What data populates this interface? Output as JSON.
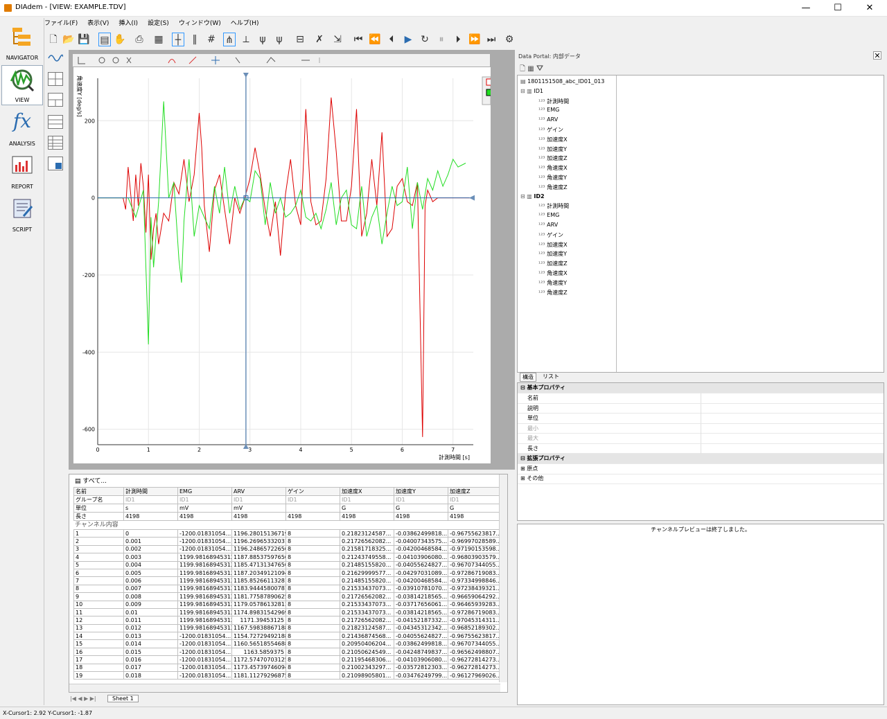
{
  "window": {
    "title": "DIAdem - [VIEW:  EXAMPLE.TDV]",
    "min": "—",
    "max": "☐",
    "close": "✕"
  },
  "menu": [
    "ファイル(F)",
    "表示(V)",
    "挿入(I)",
    "設定(S)",
    "ウィンドウ(W)",
    "ヘルプ(H)"
  ],
  "nav": [
    {
      "label": "NAVIGATOR",
      "icon": "navigator-icon"
    },
    {
      "label": "VIEW",
      "icon": "view-icon"
    },
    {
      "label": "ANALYSIS",
      "icon": "fx-icon"
    },
    {
      "label": "REPORT",
      "icon": "report-icon"
    },
    {
      "label": "SCRIPT",
      "icon": "script-icon"
    }
  ],
  "analysis_glyph": "fx",
  "chart_data": {
    "type": "line",
    "ylabel": "角速度Y [deg/s]",
    "xlabel": "計測時間 [s]",
    "xlim": [
      0,
      7.4
    ],
    "ylim": [
      -640,
      310
    ],
    "x_ticks": [
      "0",
      "1",
      "2",
      "3",
      "4",
      "5",
      "6",
      "7"
    ],
    "y_ticks": [
      "200",
      "0",
      "-200",
      "-400",
      "-600"
    ],
    "cursor_x": 2.92,
    "grid": true,
    "legend_position": "top-right",
    "series": [
      {
        "color": "#dd0000",
        "points": [
          [
            0,
            0
          ],
          [
            0.5,
            0
          ],
          [
            0.55,
            -30
          ],
          [
            0.6,
            80
          ],
          [
            0.7,
            -60
          ],
          [
            0.75,
            60
          ],
          [
            0.8,
            -20
          ],
          [
            0.85,
            90
          ],
          [
            0.9,
            30
          ],
          [
            0.95,
            -90
          ],
          [
            1.0,
            60
          ],
          [
            1.05,
            -160
          ],
          [
            1.1,
            -80
          ],
          [
            1.15,
            -40
          ],
          [
            1.2,
            -120
          ],
          [
            1.3,
            -40
          ],
          [
            1.4,
            -60
          ],
          [
            1.5,
            40
          ],
          [
            1.6,
            10
          ],
          [
            1.7,
            100
          ],
          [
            1.8,
            -10
          ],
          [
            1.9,
            60
          ],
          [
            2.0,
            220
          ],
          [
            2.05,
            130
          ],
          [
            2.1,
            -20
          ],
          [
            2.2,
            -140
          ],
          [
            2.3,
            20
          ],
          [
            2.4,
            60
          ],
          [
            2.5,
            -30
          ],
          [
            2.6,
            -120
          ],
          [
            2.7,
            0
          ],
          [
            2.8,
            -40
          ],
          [
            2.9,
            0
          ],
          [
            3.0,
            50
          ],
          [
            3.1,
            130
          ],
          [
            3.2,
            60
          ],
          [
            3.3,
            -30
          ],
          [
            3.4,
            -100
          ],
          [
            3.5,
            -10
          ],
          [
            3.6,
            -150
          ],
          [
            3.7,
            10
          ],
          [
            3.8,
            100
          ],
          [
            3.9,
            -20
          ],
          [
            4.0,
            -70
          ],
          [
            4.1,
            230
          ],
          [
            4.2,
            -10
          ],
          [
            4.3,
            -70
          ],
          [
            4.4,
            -60
          ],
          [
            4.5,
            50
          ],
          [
            4.6,
            260
          ],
          [
            4.7,
            120
          ],
          [
            4.8,
            -60
          ],
          [
            4.9,
            -60
          ],
          [
            5.0,
            30
          ],
          [
            5.1,
            230
          ],
          [
            5.2,
            -100
          ],
          [
            5.3,
            -40
          ],
          [
            5.4,
            100
          ],
          [
            5.5,
            -20
          ],
          [
            5.6,
            170
          ],
          [
            5.7,
            -100
          ],
          [
            5.8,
            -80
          ],
          [
            5.9,
            30
          ],
          [
            6.0,
            50
          ],
          [
            6.1,
            -10
          ],
          [
            6.2,
            -20
          ],
          [
            6.3,
            40
          ],
          [
            6.4,
            -620
          ],
          [
            6.45,
            -20
          ],
          [
            6.5,
            20
          ],
          [
            6.6,
            -10
          ],
          [
            6.7,
            0
          ],
          [
            7.4,
            0
          ]
        ]
      },
      {
        "color": "#22dd22",
        "points": [
          [
            0,
            0
          ],
          [
            0.6,
            0
          ],
          [
            0.75,
            -50
          ],
          [
            0.9,
            20
          ],
          [
            1.0,
            -380
          ],
          [
            1.05,
            -50
          ],
          [
            1.1,
            -180
          ],
          [
            1.2,
            -10
          ],
          [
            1.3,
            250
          ],
          [
            1.4,
            0
          ],
          [
            1.5,
            40
          ],
          [
            1.6,
            -160
          ],
          [
            1.65,
            -220
          ],
          [
            1.7,
            -60
          ],
          [
            1.8,
            100
          ],
          [
            1.9,
            -100
          ],
          [
            2.0,
            -20
          ],
          [
            2.1,
            -50
          ],
          [
            2.2,
            -80
          ],
          [
            2.3,
            30
          ],
          [
            2.4,
            -40
          ],
          [
            2.5,
            80
          ],
          [
            2.6,
            -40
          ],
          [
            2.7,
            30
          ],
          [
            2.8,
            -30
          ],
          [
            2.9,
            0
          ],
          [
            3.0,
            -10
          ],
          [
            3.1,
            70
          ],
          [
            3.2,
            50
          ],
          [
            3.3,
            -70
          ],
          [
            3.4,
            40
          ],
          [
            3.5,
            -40
          ],
          [
            3.6,
            0
          ],
          [
            3.7,
            -50
          ],
          [
            3.8,
            -40
          ],
          [
            3.9,
            -20
          ],
          [
            4.0,
            20
          ],
          [
            4.1,
            -50
          ],
          [
            4.2,
            -60
          ],
          [
            4.3,
            -40
          ],
          [
            4.4,
            -80
          ],
          [
            4.5,
            -30
          ],
          [
            4.6,
            40
          ],
          [
            4.7,
            -70
          ],
          [
            4.8,
            0
          ],
          [
            4.9,
            20
          ],
          [
            5.0,
            -70
          ],
          [
            5.1,
            -80
          ],
          [
            5.2,
            30
          ],
          [
            5.3,
            -100
          ],
          [
            5.4,
            -50
          ],
          [
            5.5,
            -20
          ],
          [
            5.6,
            -120
          ],
          [
            5.7,
            -40
          ],
          [
            5.8,
            30
          ],
          [
            5.9,
            -20
          ],
          [
            6.0,
            -10
          ],
          [
            6.1,
            80
          ],
          [
            6.2,
            -80
          ],
          [
            6.3,
            40
          ],
          [
            6.4,
            -30
          ],
          [
            6.5,
            50
          ],
          [
            6.6,
            20
          ],
          [
            6.7,
            70
          ],
          [
            6.8,
            30
          ],
          [
            6.9,
            60
          ],
          [
            7.0,
            100
          ],
          [
            7.1,
            80
          ],
          [
            7.25,
            90
          ]
        ]
      }
    ]
  },
  "table": {
    "header_label": "すべて...",
    "columns": [
      "名前",
      "計測時間",
      "EMG",
      "ARV",
      "ゲイン",
      "加速度X",
      "加速度Y",
      "加速度Z"
    ],
    "meta": [
      [
        "グループ名",
        "ID1",
        "ID1",
        "ID1",
        "ID1",
        "ID1",
        "ID1",
        "ID1"
      ],
      [
        "単位",
        "s",
        "mV",
        "mV",
        "",
        "G",
        "G",
        "G"
      ],
      [
        "長さ",
        "4198",
        "4198",
        "4198",
        "4198",
        "4198",
        "4198",
        "4198"
      ]
    ],
    "content_label": "チャンネル内容",
    "rows": [
      [
        "1",
        "0",
        "-1200.01831054...",
        "1196.28015136719",
        "8",
        "0.21823124587...",
        "-0.03862499818...",
        "-0.96755623817..."
      ],
      [
        "2",
        "0.001",
        "-1200.01831054...",
        "1196.26965332031",
        "8",
        "0.21726562082...",
        "-0.04007343575...",
        "-0.96997028589..."
      ],
      [
        "3",
        "0.002",
        "-1200.01831054...",
        "1196.24865722656",
        "8",
        "0.21581718325...",
        "-0.04200468584...",
        "-0.97190153598..."
      ],
      [
        "4",
        "0.003",
        "1199.98168945312",
        "1187.88537597656",
        "8",
        "0.21243749558...",
        "-0.04103906080...",
        "-0.96803903579..."
      ],
      [
        "5",
        "0.004",
        "1199.98168945312",
        "1185.47131347656",
        "8",
        "0.21485155820...",
        "-0.04055624827...",
        "-0.96707344055..."
      ],
      [
        "6",
        "0.005",
        "1199.98168945312",
        "1187.20349121094",
        "8",
        "0.21629999577...",
        "-0.04297031089...",
        "-0.97286719083..."
      ],
      [
        "7",
        "0.006",
        "1199.98168945312",
        "1185.85266113281",
        "8",
        "0.21485155820...",
        "-0.04200468584...",
        "-0.97334998846..."
      ],
      [
        "8",
        "0.007",
        "1199.98168945312",
        "1183.94445800781",
        "8",
        "0.21533437073...",
        "-0.03910781070...",
        "-0.97238439321..."
      ],
      [
        "9",
        "0.008",
        "1199.98168945312",
        "1181.77587890625",
        "8",
        "0.21726562082...",
        "-0.03814218565...",
        "-0.96659064292..."
      ],
      [
        "10",
        "0.009",
        "1199.98168945312",
        "1179.05786132813",
        "8",
        "0.21533437073...",
        "-0.03717656061...",
        "-0.96465939283..."
      ],
      [
        "11",
        "0.01",
        "1199.98168945312",
        "1174.89831542969",
        "8",
        "0.21533437073...",
        "-0.03814218565...",
        "-0.97286719083..."
      ],
      [
        "12",
        "0.011",
        "1199.98168945312",
        "1171.39453125",
        "8",
        "0.21726562082...",
        "-0.04152187332...",
        "-0.97045314311..."
      ],
      [
        "13",
        "0.012",
        "1199.98168945312",
        "1167.59838867188",
        "8",
        "0.21823124587...",
        "-0.04345312342...",
        "-0.96852189302..."
      ],
      [
        "14",
        "0.013",
        "-1200.01831054...",
        "1154.72729492188",
        "8",
        "0.21436874568...",
        "-0.04055624827...",
        "-0.96755623817..."
      ],
      [
        "15",
        "0.014",
        "-1200.01831054...",
        "1160.56518554688",
        "8",
        "0.20950406204...",
        "-0.03862499818...",
        "-0.96707344055..."
      ],
      [
        "16",
        "0.015",
        "-1200.01831054...",
        "1163.5859375",
        "8",
        "0.21050624549...",
        "-0.04248749837...",
        "-0.96562498807..."
      ],
      [
        "17",
        "0.016",
        "-1200.01831054...",
        "1172.57470703125",
        "8",
        "0.21195468306...",
        "-0.04103906080...",
        "-0.96272814273..."
      ],
      [
        "18",
        "0.017",
        "-1200.01831054...",
        "1173.45739746094",
        "8",
        "0.21002343297...",
        "-0.03572812303...",
        "-0.96272814273..."
      ],
      [
        "19",
        "0.018",
        "-1200.01831054...",
        "1181.11279296875",
        "8",
        "0.21098905801...",
        "-0.03476249799...",
        "-0.96127969026..."
      ]
    ]
  },
  "sheet_tab": "Sheet 1",
  "status": "X-Cursor1: 2.92 Y-Cursor1: -1.87",
  "portal": {
    "title": "Data Portal: 内部データ",
    "root": "1801151508_abc_ID01_013",
    "groups": [
      {
        "name": "ID1",
        "channels": [
          "計測時間",
          "EMG",
          "ARV",
          "ゲイン",
          "加速度X",
          "加速度Y",
          "加速度Z",
          "角速度X",
          "角速度Y",
          "角速度Z"
        ]
      },
      {
        "name": "ID2",
        "channels": [
          "計測時間",
          "EMG",
          "ARV",
          "ゲイン",
          "加速度X",
          "加速度Y",
          "加速度Z",
          "角速度X",
          "角速度Y",
          "角速度Z"
        ]
      }
    ],
    "tabs": [
      "構造",
      "リスト"
    ],
    "props": {
      "basic": "基本プロパティ",
      "basic_items": [
        "名前",
        "説明",
        "単位",
        "最小",
        "最大",
        "長さ"
      ],
      "ext": "拡張プロパティ",
      "ext_items": [
        "原点",
        "その他"
      ]
    },
    "preview": "チャンネルプレビューは終了しました。"
  }
}
